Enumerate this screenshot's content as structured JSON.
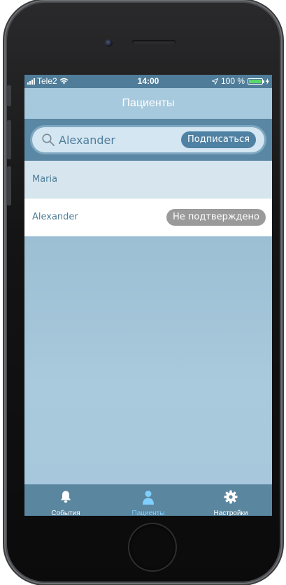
{
  "status_bar": {
    "carrier": "Tele2",
    "time": "14:00",
    "battery_percent": "100 %"
  },
  "nav": {
    "title": "Пациенты"
  },
  "search": {
    "value": "Alexander",
    "subscribe_label": "Подписаться"
  },
  "patients": [
    {
      "name": "Maria",
      "status": ""
    },
    {
      "name": "Alexander",
      "status": "Не подтверждено"
    }
  ],
  "tabs": [
    {
      "label": "События",
      "icon": "bell-icon",
      "active": false
    },
    {
      "label": "Пациенты",
      "icon": "person-icon",
      "active": true
    },
    {
      "label": "Настройки",
      "icon": "gear-icon",
      "active": false
    }
  ],
  "colors": {
    "accent": "#4f81a3",
    "tab_active": "#7fd0ff",
    "badge_gray": "#9a9a9a",
    "battery_green": "#5bd66a"
  }
}
